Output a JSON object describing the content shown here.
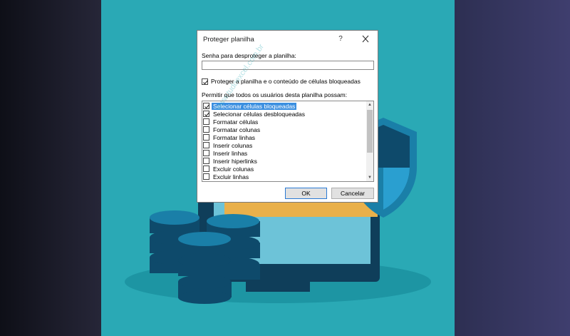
{
  "dialog": {
    "title": "Proteger planilha",
    "help_label": "?",
    "password_label": "Senha para desproteger a planilha:",
    "password_value": "",
    "protect_label": "Proteger a planilha e o conteúdo de células bloqueadas",
    "protect_checked": true,
    "allow_label": "Permitir que todos os usuários desta planilha possam:",
    "permissions": [
      {
        "label": "Selecionar células bloqueadas",
        "checked": true,
        "selected": true
      },
      {
        "label": "Selecionar células desbloqueadas",
        "checked": true,
        "selected": false
      },
      {
        "label": "Formatar células",
        "checked": false,
        "selected": false
      },
      {
        "label": "Formatar colunas",
        "checked": false,
        "selected": false
      },
      {
        "label": "Formatar linhas",
        "checked": false,
        "selected": false
      },
      {
        "label": "Inserir colunas",
        "checked": false,
        "selected": false
      },
      {
        "label": "Inserir linhas",
        "checked": false,
        "selected": false
      },
      {
        "label": "Inserir hiperlinks",
        "checked": false,
        "selected": false
      },
      {
        "label": "Excluir colunas",
        "checked": false,
        "selected": false
      },
      {
        "label": "Excluir linhas",
        "checked": false,
        "selected": false
      }
    ],
    "ok_label": "OK",
    "cancel_label": "Cancelar"
  },
  "watermark": "www.tudoexcel.com.br",
  "colors": {
    "teal": "#2aa9b5",
    "accent": "#3b8fe0",
    "shield": "#0e4a6b",
    "folder": "#e9b04a"
  }
}
